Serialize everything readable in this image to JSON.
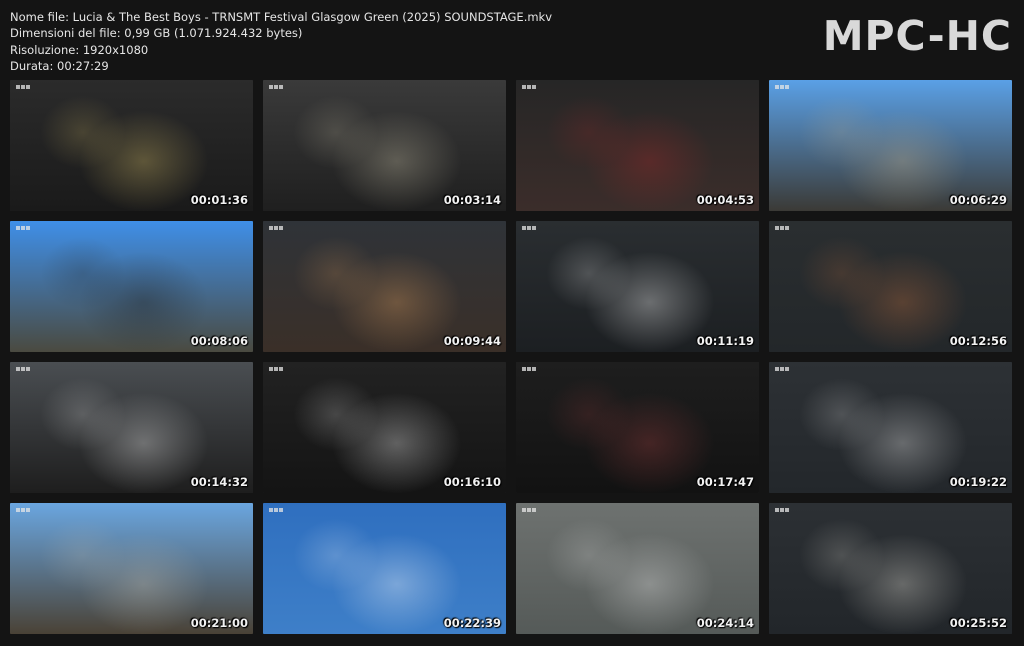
{
  "file_info": {
    "name_line": "Nome file: Lucia & The Best Boys - TRNSMT Festival Glasgow Green (2025) SOUNDSTAGE.mkv",
    "size_line": "Dimensioni del file: 0,99 GB (1.071.924.432 bytes)",
    "resolution_line": "Risoluzione: 1920x1080",
    "duration_line": "Durata: 00:27:29"
  },
  "logo": "MPC-HC",
  "thumbnails": [
    {
      "time": "00:01:36",
      "scene": "guitarist-on-stage-with-lucia-banner",
      "colors": {
        "top": "#2b2b2b",
        "bottom": "#1a1a1a",
        "accent": "#d8c06a"
      }
    },
    {
      "time": "00:03:14",
      "scene": "singer-with-sunglasses-at-mic",
      "colors": {
        "top": "#3a3a3a",
        "bottom": "#1f1f1f",
        "accent": "#c9c2a8"
      }
    },
    {
      "time": "00:04:53",
      "scene": "bassist-red-bass-closeup",
      "colors": {
        "top": "#262626",
        "bottom": "#3b2d2a",
        "accent": "#a52a2a"
      }
    },
    {
      "time": "00:06:29",
      "scene": "outdoor-stage-crowd-blue-sky",
      "colors": {
        "top": "#5aa0e6",
        "bottom": "#3b3a36",
        "accent": "#c9b28a"
      }
    },
    {
      "time": "00:08:06",
      "scene": "silhouette-singer-blue-sky-crowd",
      "colors": {
        "top": "#3f8fe8",
        "bottom": "#4a4a40",
        "accent": "#1a1a1a"
      }
    },
    {
      "time": "00:09:44",
      "scene": "singer-with-acoustic-guitar",
      "colors": {
        "top": "#2f3338",
        "bottom": "#3a2f28",
        "accent": "#e0a060"
      }
    },
    {
      "time": "00:11:19",
      "scene": "singer-closeup-sunglasses-mic",
      "colors": {
        "top": "#2a2e31",
        "bottom": "#1c1f22",
        "accent": "#ffffff"
      }
    },
    {
      "time": "00:12:56",
      "scene": "guitarist-back-view-stage",
      "colors": {
        "top": "#2a2e30",
        "bottom": "#23272a",
        "accent": "#c07040"
      }
    },
    {
      "time": "00:14:32",
      "scene": "wide-stage-smoke-lights",
      "colors": {
        "top": "#4a4e52",
        "bottom": "#1e1e1e",
        "accent": "#f0f0f0"
      }
    },
    {
      "time": "00:16:10",
      "scene": "singer-gesturing-with-guitarist",
      "colors": {
        "top": "#222222",
        "bottom": "#141414",
        "accent": "#efefef"
      }
    },
    {
      "time": "00:17:47",
      "scene": "singer-closeup-red-sunglasses",
      "colors": {
        "top": "#1e1e1e",
        "bottom": "#121212",
        "accent": "#a04040"
      }
    },
    {
      "time": "00:19:22",
      "scene": "singer-and-guitarist-side-stage",
      "colors": {
        "top": "#2d3135",
        "bottom": "#23272b",
        "accent": "#e8e8e8"
      }
    },
    {
      "time": "00:21:00",
      "scene": "keyboard-player-outdoor-crowd",
      "colors": {
        "top": "#6aa6e0",
        "bottom": "#4a4236",
        "accent": "#c8c0b0"
      }
    },
    {
      "time": "00:22:39",
      "scene": "sun-flare-blue-sky",
      "colors": {
        "top": "#2f6fbf",
        "bottom": "#3e7fc8",
        "accent": "#ffffff"
      }
    },
    {
      "time": "00:24:14",
      "scene": "microphone-closeup-hand",
      "colors": {
        "top": "#6e7270",
        "bottom": "#555a58",
        "accent": "#e8e8e8"
      }
    },
    {
      "time": "00:25:52",
      "scene": "guitar-neck-closeup",
      "colors": {
        "top": "#2c3034",
        "bottom": "#22262a",
        "accent": "#e9e6dc"
      }
    }
  ]
}
